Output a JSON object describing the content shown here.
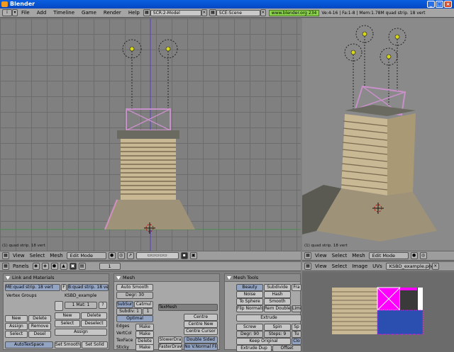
{
  "window": {
    "title": "Blender"
  },
  "menu": {
    "items": [
      "File",
      "Add",
      "Timeline",
      "Game",
      "Render",
      "Help"
    ],
    "screen": "SCR:2-Model",
    "scene": "SCE:Scene",
    "url": "www.blender.org 234",
    "stats": "Ve:4-16 | Fa:1-8 | Mem:1.78M quad strip. 18 vert"
  },
  "viewports": {
    "left_label": "(1) quad strip. 18 vert",
    "right_label": "(1) quad strip. 18 vert"
  },
  "headers": {
    "view": "View",
    "select": "Select",
    "mesh": "Mesh",
    "mode": "Edit Mode",
    "image_view": "View",
    "image_select": "Select",
    "image": "Image",
    "uvs": "UVs",
    "image_name": "KSBD_example.png"
  },
  "panels_bar": {
    "label": "Panels",
    "page": "1"
  },
  "link_materials": {
    "title": "Link and Materials",
    "me_field": "ME:quad strip. 18 vert",
    "f_label": "F",
    "ob_field": "B:quad strip. 18 vert",
    "vertex_groups": "Vertex Groups",
    "material_name": "KSBD_example",
    "mat_counter": "1 Mat: 1",
    "question": "?",
    "new": "New",
    "delete": "Delete",
    "assign": "Assign",
    "remove": "Remove",
    "select": "Select",
    "desel": "Desel",
    "new2": "New",
    "delete2": "Delete",
    "select2": "Select",
    "deselect2": "Deselect",
    "assign2": "Assign",
    "autotexspace": "AutoTexSpace",
    "set_smooth": "Set Smooth",
    "set_solid": "Set Solid"
  },
  "mesh": {
    "title": "Mesh",
    "auto_smooth": "Auto Smooth",
    "degr": "Degr: 30",
    "subsurf": "SubSurf",
    "catmul": "Catmul",
    "subdiv": "Subdiv: 1",
    "subdiv2": "1",
    "optimal": "Optimal",
    "texmesh": "TexMesh",
    "edges": "Edges",
    "vertcol": "VertCol",
    "texface": "TexFace",
    "sticky": "Sticky",
    "make": "Make",
    "delete": "Delete",
    "centre": "Centre",
    "centre_new": "Centre New",
    "centre_cursor": "Centre Cursor",
    "slower_draw": "SlowerDra",
    "faster_draw": "FasterDraw",
    "double_sided": "Double Sided",
    "no_vnormal": "No V.Normal Fli"
  },
  "mesh_tools": {
    "title": "Mesh Tools",
    "beauty": "Beauty",
    "subdivide": "Subdivide",
    "fra": "Fra",
    "noise": "Noise",
    "hash": "Hash",
    "to_sphere": "To Sphere",
    "smooth": "Smooth",
    "flip_normals": "Flip Normals",
    "rem_double": "Rem Double",
    "limit": "Limi",
    "extrude": "Extrude",
    "screw": "Screw",
    "spin": "Spin",
    "sp": "Sp",
    "degr": "Degr: 90",
    "steps": "Steps: 9",
    "tu": "Tu",
    "keep_original": "Keep Original",
    "clo": "Clo",
    "extrude_dup": "Extrude Dup",
    "offset": "Offset"
  },
  "colors": {
    "accent_blue": "#93a3c2",
    "title_blue": "#0a5fe0",
    "uv_magenta": "#ff00ff"
  }
}
